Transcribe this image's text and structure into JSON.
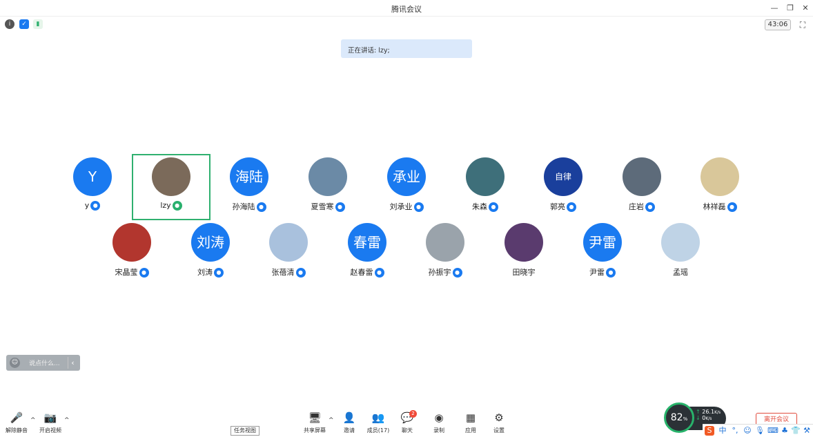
{
  "window": {
    "title": "腾讯会议",
    "minimize": "—",
    "restore": "❐",
    "close": "✕"
  },
  "status": {
    "info_icon": "i",
    "shield_icon": "✓",
    "signal_icon": "▮",
    "timer": "43:06",
    "fullscreen_icon": "⛶"
  },
  "speaking_banner": "正在讲话: lzy;",
  "participants": [
    {
      "name": "y",
      "avatar_text": "Y",
      "mic": "blue"
    },
    {
      "name": "lzy",
      "avatar_text": "",
      "mic": "green",
      "active": true
    },
    {
      "name": "孙海陆",
      "avatar_text": "海陆",
      "mic": "blue"
    },
    {
      "name": "夏雪寒",
      "avatar_text": "",
      "mic": "blue"
    },
    {
      "name": "刘承业",
      "avatar_text": "承业",
      "mic": "blue"
    },
    {
      "name": "朱森",
      "avatar_text": "",
      "mic": "blue"
    },
    {
      "name": "郭亮",
      "avatar_text": "自律",
      "mic": "blue"
    },
    {
      "name": "庄岩",
      "avatar_text": "",
      "mic": "blue"
    },
    {
      "name": "林祥磊",
      "avatar_text": "",
      "mic": "blue"
    },
    {
      "name": "宋晶莹",
      "avatar_text": "",
      "mic": "blue"
    },
    {
      "name": "刘涛",
      "avatar_text": "刘涛",
      "mic": "blue"
    },
    {
      "name": "张蓓清",
      "avatar_text": "",
      "mic": "blue"
    },
    {
      "name": "赵春雷",
      "avatar_text": "春雷",
      "mic": "blue"
    },
    {
      "name": "孙振宇",
      "avatar_text": "",
      "mic": "blue"
    },
    {
      "name": "田晓宇",
      "avatar_text": "",
      "mic": "none"
    },
    {
      "name": "尹雷",
      "avatar_text": "尹雷",
      "mic": "blue"
    },
    {
      "name": "孟瑶",
      "avatar_text": "",
      "mic": "none"
    }
  ],
  "chat": {
    "placeholder": "说点什么...",
    "smile_icon": "☺",
    "collapse_icon": "‹"
  },
  "toolbar": {
    "unmute": {
      "label": "解除静音",
      "icon": "🎤"
    },
    "video": {
      "label": "开启视频",
      "icon": "📷"
    },
    "share": {
      "label": "共享屏幕",
      "icon": "🖥"
    },
    "invite": {
      "label": "邀请",
      "icon": "👤"
    },
    "members": {
      "label": "成员(17)",
      "icon": "👥"
    },
    "chat": {
      "label": "聊天",
      "icon": "💬",
      "badge": "2"
    },
    "record": {
      "label": "录制",
      "icon": "◉"
    },
    "apps": {
      "label": "应用",
      "icon": "▦"
    },
    "settings": {
      "label": "设置",
      "icon": "⚙"
    },
    "caret": "^",
    "tooltip": "任务视图"
  },
  "overlay": {
    "gauge_value": "82",
    "gauge_unit": "%",
    "net_up": "26.1",
    "net_up_unit": "K/s",
    "net_down": "0",
    "net_down_unit": "K/s",
    "leave": "离开会议"
  },
  "ime": {
    "logo": "S",
    "lang": "中",
    "punct": "°,",
    "emoji": "☺",
    "mic": "🎙",
    "keyboard": "⌨",
    "skin": "♣",
    "shirt": "👕",
    "tools": "⚒"
  },
  "colors": {
    "accent_blue": "#1a7af0",
    "active_green": "#2fb06f",
    "banner_bg": "#dbe9fb",
    "leave_red": "#e14b3d"
  }
}
